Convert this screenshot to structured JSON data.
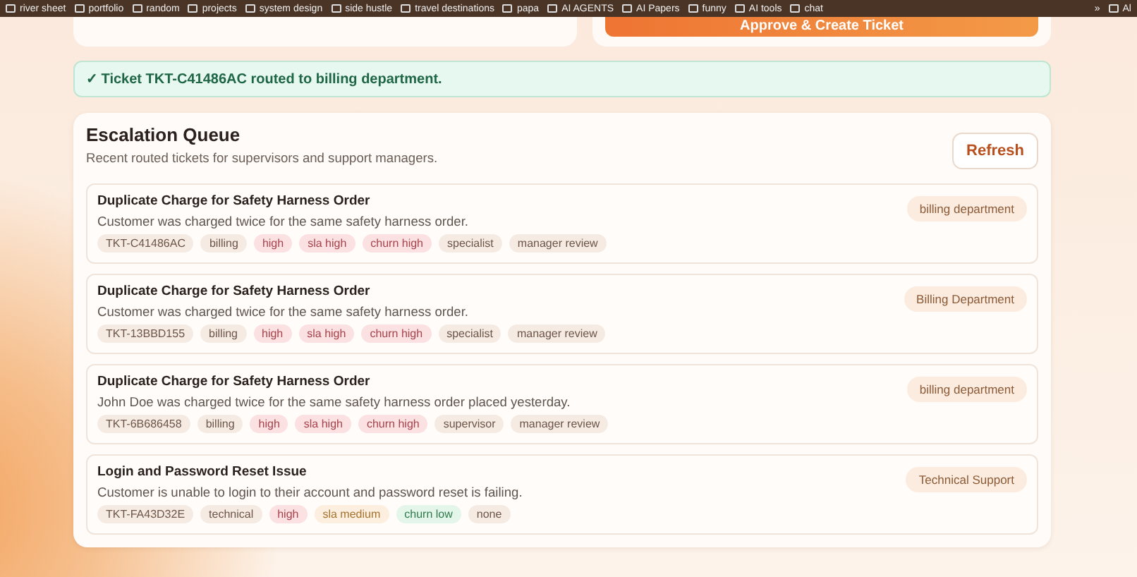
{
  "bookmarks_bar": {
    "items": [
      "river sheet",
      "portfolio",
      "random",
      "projects",
      "system design",
      "side hustle",
      "travel destinations",
      "papa",
      "AI AGENTS",
      "AI Papers",
      "funny",
      "AI tools",
      "chat"
    ],
    "overflow": "»",
    "all": "Al"
  },
  "top_cards": {
    "approve_button": "Approve & Create Ticket"
  },
  "notice": "✓ Ticket TKT-C41486AC routed to billing department.",
  "queue": {
    "title": "Escalation Queue",
    "subtitle": "Recent routed tickets for supervisors and support managers.",
    "refresh": "Refresh",
    "tickets": [
      {
        "title": "Duplicate Charge for Safety Harness Order",
        "summary": "Customer was charged twice for the same safety harness order.",
        "department": "billing department",
        "tags": [
          {
            "text": "TKT-C41486AC",
            "kind": "id"
          },
          {
            "text": "billing",
            "kind": "neutral"
          },
          {
            "text": "high",
            "kind": "alert"
          },
          {
            "text": "sla high",
            "kind": "alert"
          },
          {
            "text": "churn high",
            "kind": "alert"
          },
          {
            "text": "specialist",
            "kind": "neutral"
          },
          {
            "text": "manager review",
            "kind": "neutral"
          }
        ]
      },
      {
        "title": "Duplicate Charge for Safety Harness Order",
        "summary": "Customer was charged twice for the same safety harness order.",
        "department": "Billing Department",
        "tags": [
          {
            "text": "TKT-13BBD155",
            "kind": "id"
          },
          {
            "text": "billing",
            "kind": "neutral"
          },
          {
            "text": "high",
            "kind": "alert"
          },
          {
            "text": "sla high",
            "kind": "alert"
          },
          {
            "text": "churn high",
            "kind": "alert"
          },
          {
            "text": "specialist",
            "kind": "neutral"
          },
          {
            "text": "manager review",
            "kind": "neutral"
          }
        ]
      },
      {
        "title": "Duplicate Charge for Safety Harness Order",
        "summary": "John Doe was charged twice for the same safety harness order placed yesterday.",
        "department": "billing department",
        "tags": [
          {
            "text": "TKT-6B686458",
            "kind": "id"
          },
          {
            "text": "billing",
            "kind": "neutral"
          },
          {
            "text": "high",
            "kind": "alert"
          },
          {
            "text": "sla high",
            "kind": "alert"
          },
          {
            "text": "churn high",
            "kind": "alert"
          },
          {
            "text": "supervisor",
            "kind": "neutral"
          },
          {
            "text": "manager review",
            "kind": "neutral"
          }
        ]
      },
      {
        "title": "Login and Password Reset Issue",
        "summary": "Customer is unable to login to their account and password reset is failing.",
        "department": "Technical Support",
        "tags": [
          {
            "text": "TKT-FA43D32E",
            "kind": "id"
          },
          {
            "text": "technical",
            "kind": "neutral"
          },
          {
            "text": "high",
            "kind": "alert"
          },
          {
            "text": "sla medium",
            "kind": "warn"
          },
          {
            "text": "churn low",
            "kind": "ok"
          },
          {
            "text": "none",
            "kind": "neutral"
          }
        ]
      }
    ]
  }
}
